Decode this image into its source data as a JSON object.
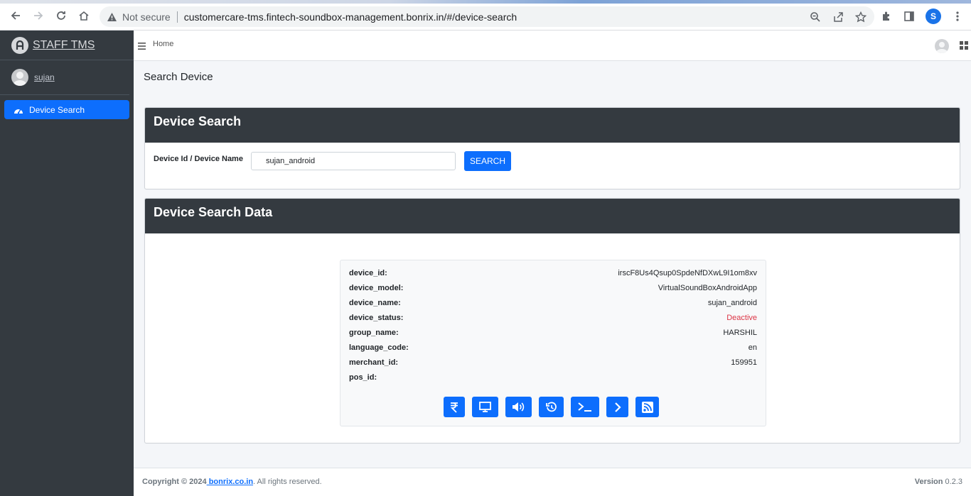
{
  "browser": {
    "security_label": "Not secure",
    "url": "customercare-tms.fintech-soundbox-management.bonrix.in/#/device-search",
    "profile_letter": "S"
  },
  "sidebar": {
    "brand": "STAFF TMS",
    "user": "sujan",
    "items": [
      {
        "label": "Device Search",
        "icon": "dashboard-gauge-icon",
        "active": true
      }
    ]
  },
  "topbar": {
    "home_label": "Home"
  },
  "page": {
    "title": "Search Device"
  },
  "search_card": {
    "header": "Device Search",
    "field_label": "Device Id / Device Name",
    "field_value": "sujan_android",
    "button_label": "SEARCH"
  },
  "results_card": {
    "header": "Device Search Data",
    "fields": [
      {
        "key": "device_id:",
        "value": "irscF8Us4Qsup0SpdeNfDXwL9I1om8xv"
      },
      {
        "key": "device_model:",
        "value": "VirtualSoundBoxAndroidApp"
      },
      {
        "key": "device_name:",
        "value": "sujan_android"
      },
      {
        "key": "device_status:",
        "value": "Deactive"
      },
      {
        "key": "group_name:",
        "value": "HARSHIL"
      },
      {
        "key": "language_code:",
        "value": "en"
      },
      {
        "key": "merchant_id:",
        "value": "159951"
      },
      {
        "key": "pos_id:",
        "value": ""
      }
    ],
    "actions": [
      "rupee-icon",
      "monitor-icon",
      "volume-icon",
      "history-icon",
      "terminal-icon",
      "chevron-right-icon",
      "rss-feed-icon"
    ]
  },
  "colors": {
    "primary": "#0d6efd",
    "sidebar_bg": "#343a40",
    "status_deactive": "#dc3545"
  },
  "footer": {
    "copyright_prefix": "Copyright © 2024",
    "link_text": " bonrix.co.in",
    "suffix": ". All rights reserved.",
    "version_label": "Version",
    "version_value": "0.2.3"
  }
}
